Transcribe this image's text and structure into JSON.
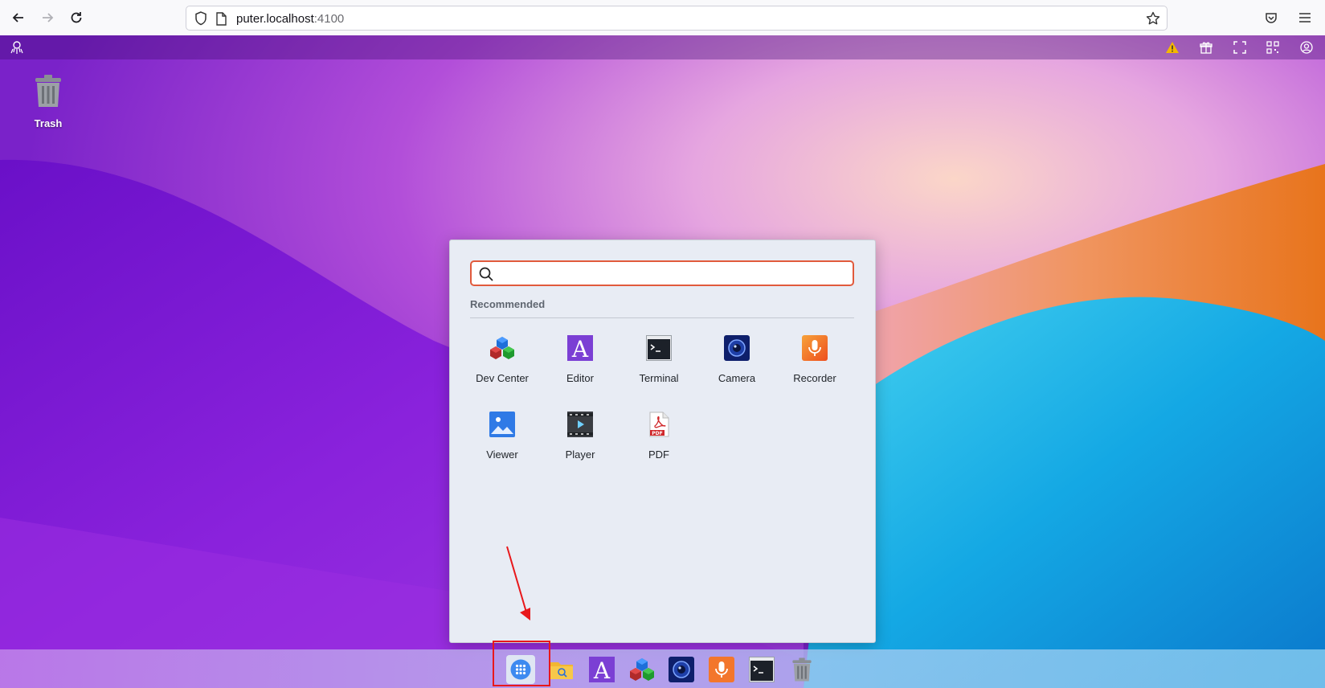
{
  "browser": {
    "url_host": "puter.localhost",
    "url_port": ":4100"
  },
  "desktop": {
    "items": [
      {
        "label": "Trash",
        "icon": "trash-icon"
      }
    ]
  },
  "launcher": {
    "search_placeholder": "",
    "recommended_title": "Recommended",
    "apps": [
      {
        "label": "Dev Center",
        "icon": "dev-center-icon"
      },
      {
        "label": "Editor",
        "icon": "editor-icon"
      },
      {
        "label": "Terminal",
        "icon": "terminal-icon"
      },
      {
        "label": "Camera",
        "icon": "camera-icon"
      },
      {
        "label": "Recorder",
        "icon": "recorder-icon"
      },
      {
        "label": "Viewer",
        "icon": "viewer-icon"
      },
      {
        "label": "Player",
        "icon": "player-icon"
      },
      {
        "label": "PDF",
        "icon": "pdf-icon"
      }
    ]
  },
  "taskbar": {
    "items": [
      "launcher-icon",
      "files-icon",
      "editor-icon",
      "dev-center-icon",
      "camera-icon",
      "recorder-icon",
      "terminal-icon",
      "trash-icon"
    ]
  },
  "colors": {
    "search_border": "#e15a3c",
    "annotation_red": "#e8181b",
    "warning": "#f5b800"
  }
}
